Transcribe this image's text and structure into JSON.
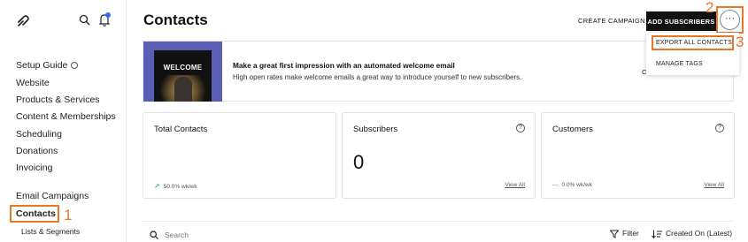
{
  "sidebar": {
    "items": [
      {
        "label": "Setup Guide"
      },
      {
        "label": "Website"
      },
      {
        "label": "Products & Services"
      },
      {
        "label": "Content & Memberships"
      },
      {
        "label": "Scheduling"
      },
      {
        "label": "Donations"
      },
      {
        "label": "Invoicing"
      },
      {
        "label": "Email Campaigns"
      },
      {
        "label": "Contacts"
      },
      {
        "label": "Lists & Segments"
      }
    ]
  },
  "header": {
    "title": "Contacts",
    "create_campaign": "CREATE CAMPAIGN",
    "add_subscribers": "ADD SUBSCRIBERS",
    "more": "···"
  },
  "dropdown": {
    "items": [
      {
        "label": "EXPORT ALL CONTACTS"
      },
      {
        "label": "MANAGE TAGS"
      }
    ]
  },
  "banner": {
    "phone_text": "WELCOME",
    "title": "Make a great first impression with an automated welcome email",
    "text": "High open rates make welcome emails a great way to introduce yourself to new subscribers.",
    "cut_button": "C"
  },
  "cards": [
    {
      "title": "Total Contacts",
      "stat_value": "50.0%",
      "stat_unit": "wk/wk"
    },
    {
      "title": "Subscribers",
      "value": "0",
      "link": "View All"
    },
    {
      "title": "Customers",
      "stat_value": "0.0%",
      "stat_unit": "wk/wk",
      "link": "View All"
    }
  ],
  "toolbar": {
    "search_placeholder": "Search",
    "filter": "Filter",
    "sort": "Created On (Latest)"
  },
  "annotations": [
    "1",
    "2",
    "3"
  ],
  "colors": {
    "accent_orange": "#e8762b",
    "banner_purple": "#5a5fb5",
    "primary_button": "#111111",
    "trend_up": "#2a9d62",
    "notification_dot": "#2f6fed"
  },
  "icons": [
    "squarespace-logo-icon",
    "search-icon",
    "bell-icon",
    "help-icon",
    "trend-up-icon",
    "filter-icon",
    "sort-icon"
  ]
}
